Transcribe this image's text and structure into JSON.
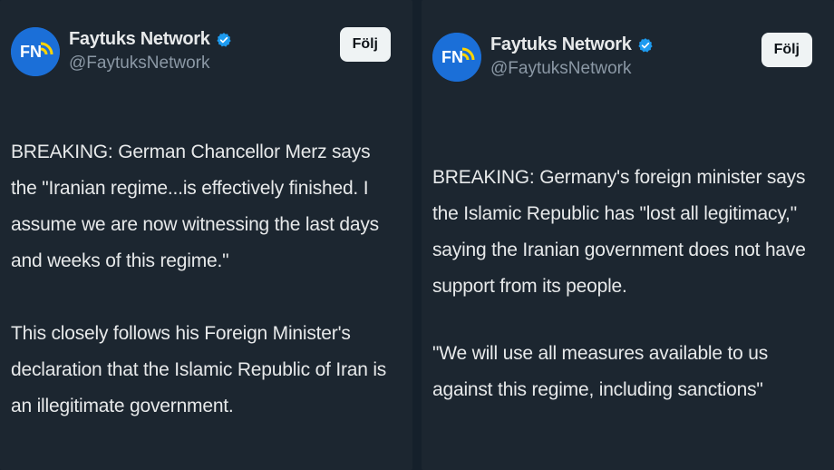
{
  "posts": [
    {
      "account": {
        "name": "Faytuks Network",
        "handle": "@FaytuksNetwork",
        "avatar_initials": "FN",
        "verified_icon": "verified-badge-icon",
        "follow_label": "Följ"
      },
      "paragraphs": [
        "BREAKING: German Chancellor Merz says the \"Iranian regime...is effectively finished. I assume we are now witnessing the last days and weeks of this regime.\"",
        "This closely follows his Foreign Minister's declaration that the Islamic Republic of Iran is an illegitimate government."
      ]
    },
    {
      "account": {
        "name": "Faytuks Network",
        "handle": "@FaytuksNetwork",
        "avatar_initials": "FN",
        "verified_icon": "verified-badge-icon",
        "follow_label": "Följ"
      },
      "paragraphs": [
        "BREAKING: Germany's foreign minister says the Islamic Republic has \"lost all legitimacy,\" saying the Iranian government does not have support from its people.",
        "\"We will use all measures available to us against this regime, including sanctions\""
      ]
    }
  ],
  "colors": {
    "background": "#15202b",
    "panel": "#1c2630",
    "text": "#e7e9ea",
    "muted": "#8b98a5",
    "verified": "#1d9bf0",
    "avatar": "#1b6fd8"
  }
}
